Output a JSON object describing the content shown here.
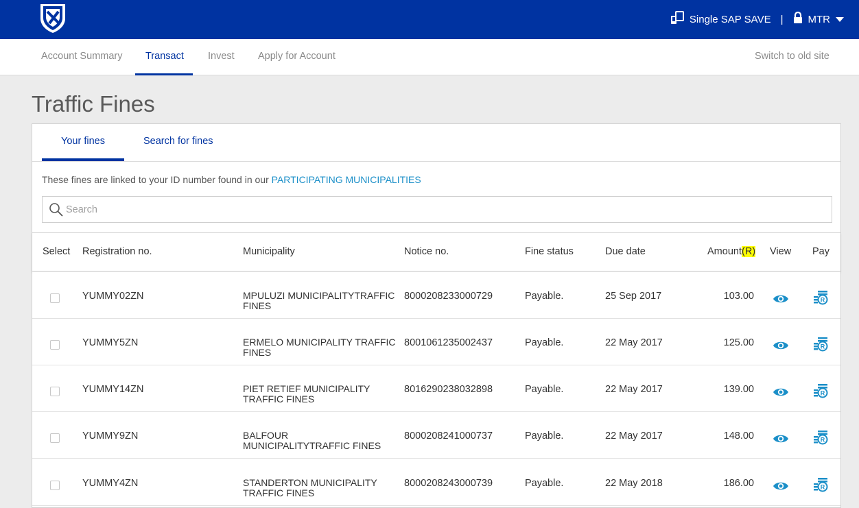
{
  "header": {
    "sap_label": "Single SAP SAVE",
    "separator": "|",
    "user": "MTR",
    "brand_color": "#0033a1"
  },
  "nav": {
    "items": [
      {
        "label": "Account Summary"
      },
      {
        "label": "Transact"
      },
      {
        "label": "Invest"
      },
      {
        "label": "Apply for Account"
      }
    ],
    "active": "Transact",
    "switch_label": "Switch to old site"
  },
  "page": {
    "title": "Traffic Fines"
  },
  "tabs": [
    {
      "label": "Your fines"
    },
    {
      "label": "Search for fines"
    }
  ],
  "info": {
    "text": "These fines are linked to your ID number found in our ",
    "link": "PARTICIPATING MUNICIPALITIES"
  },
  "search": {
    "placeholder": "Search"
  },
  "table": {
    "headers": {
      "select": "Select",
      "registration": "Registration no.",
      "municipality": "Municipality",
      "notice": "Notice no.",
      "status": "Fine status",
      "due": "Due date",
      "amount": "Amount",
      "amount_unit": "(R)",
      "view": "View",
      "pay": "Pay"
    },
    "rows": [
      {
        "registration": "YUMMY02ZN",
        "municipality": "MPULUZI MUNICIPALITYTRAFFIC FINES",
        "notice": "8000208233000729",
        "status": "Payable.",
        "due": "25 Sep 2017",
        "amount": "103.00"
      },
      {
        "registration": "YUMMY5ZN",
        "municipality": "ERMELO MUNICIPALITY TRAFFIC FINES",
        "notice": "8001061235002437",
        "status": "Payable.",
        "due": "22 May 2017",
        "amount": "125.00"
      },
      {
        "registration": "YUMMY14ZN",
        "municipality": "PIET RETIEF MUNICIPALITY TRAFFIC FINES",
        "notice": "8016290238032898",
        "status": "Payable.",
        "due": "22 May 2017",
        "amount": "139.00"
      },
      {
        "registration": "YUMMY9ZN",
        "municipality": "BALFOUR MUNICIPALITYTRAFFIC FINES",
        "notice": "8000208241000737",
        "status": "Payable.",
        "due": "22 May 2017",
        "amount": "148.00"
      },
      {
        "registration": "YUMMY4ZN",
        "municipality": "STANDERTON MUNICIPALITY TRAFFIC FINES",
        "notice": "8000208243000739",
        "status": "Payable.",
        "due": "22 May 2018",
        "amount": "186.00"
      }
    ]
  },
  "icons": {
    "logo": "shield-logo",
    "sap": "sap-devices-icon",
    "lock": "lock-icon",
    "search": "search-icon",
    "view": "eye-icon",
    "pay": "pay-coins-icon",
    "accent": "#1b8fc8"
  }
}
